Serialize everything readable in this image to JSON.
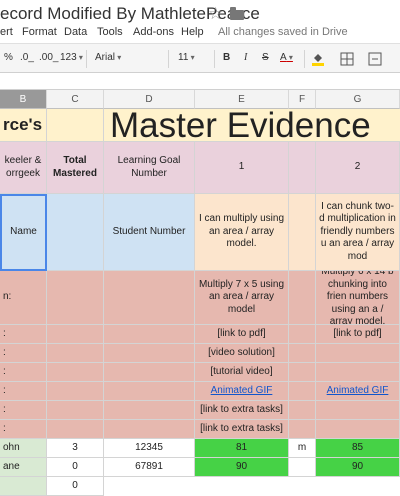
{
  "doc": {
    "title": "ecord Modified By MathletePearce",
    "star": "☆"
  },
  "menu": {
    "items": [
      "ert",
      "Format",
      "Data",
      "Tools",
      "Add-ons",
      "Help"
    ],
    "saved": "All changes saved in Drive"
  },
  "toolbar": {
    "percent": "%",
    "dec_less": ".0_",
    "dec_more": ".00_",
    "format": "123",
    "font": "Arial",
    "size": "11",
    "bold": "B",
    "italic": "I",
    "strike": "S",
    "color": "A"
  },
  "columns": [
    "B",
    "C",
    "D",
    "E",
    "F",
    "G"
  ],
  "rows": {
    "r1": {
      "b": "rce's",
      "title": "Master Evidence"
    },
    "r2": {
      "b": "keeler & orrgeek",
      "c": "Total Mastered",
      "d": "Learning Goal Number",
      "e": "1",
      "g": "2"
    },
    "r3": {
      "b": "Name",
      "d": "Student Number",
      "e": "I can multiply using an area / array model.",
      "g": "I can chunk two-d multiplication in friendly numbers u an area / array mod"
    },
    "r4": {
      "b": "n:",
      "e": "Multiply 7 x 5 using an area / array model",
      "g": "Multiply 6 x 14 b chunking into frien numbers using an a / array model."
    },
    "r5": {
      "b": ":",
      "e": "[link to pdf]",
      "g": "[link to pdf]"
    },
    "r6": {
      "b": ":",
      "e": "[video solution]"
    },
    "r7": {
      "b": ":",
      "e": "[tutorial video]"
    },
    "r8": {
      "b": ":",
      "e": "Animated GIF",
      "g": "Animated GIF"
    },
    "r9": {
      "b": ":",
      "e": "[link to extra tasks]"
    },
    "r10": {
      "b": ":",
      "e": "[link to extra tasks]"
    },
    "r11": {
      "b": "ohn",
      "c": "3",
      "d": "12345",
      "e": "81",
      "f": "m",
      "g": "85"
    },
    "r12": {
      "b": "ane",
      "c": "0",
      "d": "67891",
      "e": "90",
      "g": "90"
    },
    "r13": {
      "c": "0"
    }
  }
}
